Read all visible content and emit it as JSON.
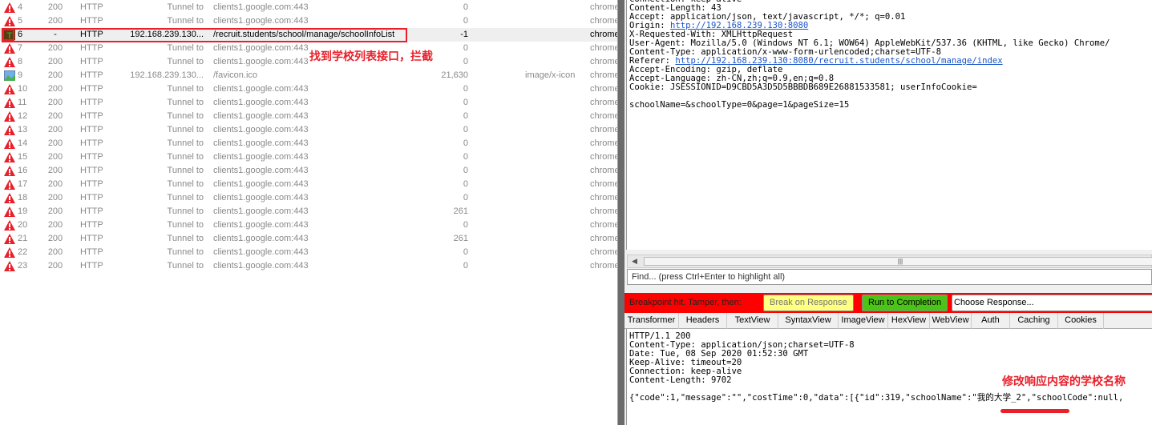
{
  "sessions": [
    {
      "num": "4",
      "result": "200",
      "protocol": "HTTP",
      "host": "Tunnel to",
      "url": "clients1.google.com:443",
      "body": "0",
      "type": "",
      "process": "chrome",
      "icon": "warning-icon"
    },
    {
      "num": "5",
      "result": "200",
      "protocol": "HTTP",
      "host": "Tunnel to",
      "url": "clients1.google.com:443",
      "body": "0",
      "type": "",
      "process": "chrome",
      "icon": "warning-icon"
    },
    {
      "num": "6",
      "result": "-",
      "protocol": "HTTP",
      "host": "192.168.239.130...",
      "url": "/recruit.students/school/manage/schoolInfoList",
      "body": "-1",
      "type": "",
      "process": "chrome",
      "icon": "breakpoint-icon",
      "selected": true
    },
    {
      "num": "7",
      "result": "200",
      "protocol": "HTTP",
      "host": "Tunnel to",
      "url": "clients1.google.com:443",
      "body": "0",
      "type": "",
      "process": "chrome",
      "icon": "warning-icon"
    },
    {
      "num": "8",
      "result": "200",
      "protocol": "HTTP",
      "host": "Tunnel to",
      "url": "clients1.google.com:443",
      "body": "0",
      "type": "",
      "process": "chrome",
      "icon": "warning-icon"
    },
    {
      "num": "9",
      "result": "200",
      "protocol": "HTTP",
      "host": "192.168.239.130...",
      "url": "/favicon.ico",
      "body": "21,630",
      "type": "image/x-icon",
      "process": "chrome",
      "icon": "image-icon"
    },
    {
      "num": "10",
      "result": "200",
      "protocol": "HTTP",
      "host": "Tunnel to",
      "url": "clients1.google.com:443",
      "body": "0",
      "type": "",
      "process": "chrome",
      "icon": "warning-icon"
    },
    {
      "num": "11",
      "result": "200",
      "protocol": "HTTP",
      "host": "Tunnel to",
      "url": "clients1.google.com:443",
      "body": "0",
      "type": "",
      "process": "chrome",
      "icon": "warning-icon"
    },
    {
      "num": "12",
      "result": "200",
      "protocol": "HTTP",
      "host": "Tunnel to",
      "url": "clients1.google.com:443",
      "body": "0",
      "type": "",
      "process": "chrome",
      "icon": "warning-icon"
    },
    {
      "num": "13",
      "result": "200",
      "protocol": "HTTP",
      "host": "Tunnel to",
      "url": "clients1.google.com:443",
      "body": "0",
      "type": "",
      "process": "chrome",
      "icon": "warning-icon"
    },
    {
      "num": "14",
      "result": "200",
      "protocol": "HTTP",
      "host": "Tunnel to",
      "url": "clients1.google.com:443",
      "body": "0",
      "type": "",
      "process": "chrome",
      "icon": "warning-icon"
    },
    {
      "num": "15",
      "result": "200",
      "protocol": "HTTP",
      "host": "Tunnel to",
      "url": "clients1.google.com:443",
      "body": "0",
      "type": "",
      "process": "chrome",
      "icon": "warning-icon"
    },
    {
      "num": "16",
      "result": "200",
      "protocol": "HTTP",
      "host": "Tunnel to",
      "url": "clients1.google.com:443",
      "body": "0",
      "type": "",
      "process": "chrome",
      "icon": "warning-icon"
    },
    {
      "num": "17",
      "result": "200",
      "protocol": "HTTP",
      "host": "Tunnel to",
      "url": "clients1.google.com:443",
      "body": "0",
      "type": "",
      "process": "chrome",
      "icon": "warning-icon"
    },
    {
      "num": "18",
      "result": "200",
      "protocol": "HTTP",
      "host": "Tunnel to",
      "url": "clients1.google.com:443",
      "body": "0",
      "type": "",
      "process": "chrome",
      "icon": "warning-icon"
    },
    {
      "num": "19",
      "result": "200",
      "protocol": "HTTP",
      "host": "Tunnel to",
      "url": "clients1.google.com:443",
      "body": "261",
      "type": "",
      "process": "chrome",
      "icon": "warning-icon"
    },
    {
      "num": "20",
      "result": "200",
      "protocol": "HTTP",
      "host": "Tunnel to",
      "url": "clients1.google.com:443",
      "body": "0",
      "type": "",
      "process": "chrome",
      "icon": "warning-icon"
    },
    {
      "num": "21",
      "result": "200",
      "protocol": "HTTP",
      "host": "Tunnel to",
      "url": "clients1.google.com:443",
      "body": "261",
      "type": "",
      "process": "chrome",
      "icon": "warning-icon"
    },
    {
      "num": "22",
      "result": "200",
      "protocol": "HTTP",
      "host": "Tunnel to",
      "url": "clients1.google.com:443",
      "body": "0",
      "type": "",
      "process": "chrome",
      "icon": "warning-icon"
    },
    {
      "num": "23",
      "result": "200",
      "protocol": "HTTP",
      "host": "Tunnel to",
      "url": "clients1.google.com:443",
      "body": "0",
      "type": "",
      "process": "chrome",
      "icon": "warning-icon"
    }
  ],
  "annotations": {
    "list": "找到学校列表接口，拦截",
    "response": "修改响应内容的学校名称"
  },
  "request": {
    "lines": [
      "Connection: keep-alive",
      "Content-Length: 43",
      "Accept: application/json, text/javascript, */*; q=0.01"
    ],
    "origin_label": "Origin: ",
    "origin_url": "http://192.168.239.130:8080",
    "lines2": [
      "X-Requested-With: XMLHttpRequest",
      "User-Agent: Mozilla/5.0 (Windows NT 6.1; WOW64) AppleWebKit/537.36 (KHTML, like Gecko) Chrome/",
      "Content-Type: application/x-www-form-urlencoded;charset=UTF-8"
    ],
    "referer_label": "Referer: ",
    "referer_url": "http://192.168.239.130:8080/recruit.students/school/manage/index",
    "lines3": [
      "Accept-Encoding: gzip, deflate",
      "Accept-Language: zh-CN,zh;q=0.9,en;q=0.8",
      "Cookie: JSESSIONID=D9CBD5A3D5D5BBBDB689E26881533581; userInfoCookie=",
      "",
      "schoolName=&schoolType=0&page=1&pageSize=15"
    ]
  },
  "find_placeholder": "Find... (press Ctrl+Enter to highlight all)",
  "breakpoint": {
    "label": "Breakpoint hit. Tamper, then:",
    "break_on_response": "Break on Response",
    "run_to_completion": "Run to Completion",
    "choose_response": "Choose Response..."
  },
  "tabs": [
    "Transformer",
    "Headers",
    "TextView",
    "SyntaxView",
    "ImageView",
    "HexView",
    "WebView",
    "Auth",
    "Caching",
    "Cookies"
  ],
  "response": {
    "lines": [
      "HTTP/1.1 200",
      "Content-Type: application/json;charset=UTF-8",
      "Date: Tue, 08 Sep 2020 01:52:30 GMT",
      "Keep-Alive: timeout=20",
      "Connection: keep-alive",
      "Content-Length: 9702",
      "",
      "{\"code\":1,\"message\":\"\",\"costTime\":0,\"data\":[{\"id\":319,\"schoolName\":\"我的大学_2\",\"schoolCode\":null,"
    ]
  },
  "colors": {
    "accent_red": "#e8202a",
    "breakpoint_bar": "#ff0000",
    "break_btn": "#ffff80",
    "run_btn": "#4cc417"
  }
}
